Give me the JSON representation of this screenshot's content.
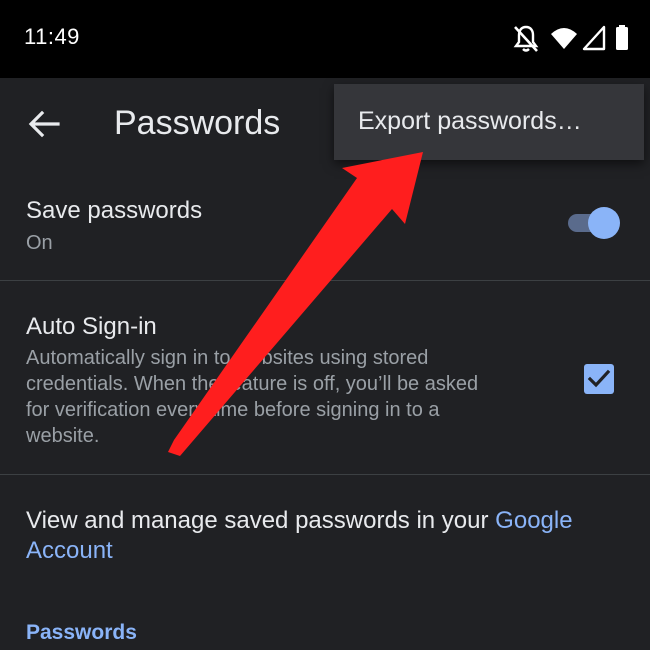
{
  "status_bar": {
    "time": "11:49",
    "icons": [
      "notifications-off-icon",
      "wifi-icon",
      "cell-signal-icon",
      "battery-icon"
    ]
  },
  "app_bar": {
    "back_icon": "arrow-left-icon",
    "title": "Passwords"
  },
  "overflow_menu": {
    "items": [
      {
        "label": "Export passwords…"
      }
    ]
  },
  "settings": {
    "save_passwords": {
      "title": "Save passwords",
      "summary": "On",
      "toggle_on": true
    },
    "auto_sign_in": {
      "title": "Auto Sign-in",
      "summary_lines": [
        "Automatically sign in to websites using stored",
        "credentials. When the feature is off, you’ll be asked",
        "for verification every time before signing in to a",
        "website."
      ],
      "checked": true
    },
    "manage": {
      "text": "View and manage saved passwords in your ",
      "link_text_1": "Google",
      "link_text_2": "Account"
    }
  },
  "section": {
    "header": "Passwords"
  },
  "annotation": {
    "type": "red-arrow-icon",
    "color": "#ff1e1e"
  },
  "colors": {
    "background": "#202124",
    "accent": "#8ab4f8",
    "menu_background": "#35363a"
  }
}
